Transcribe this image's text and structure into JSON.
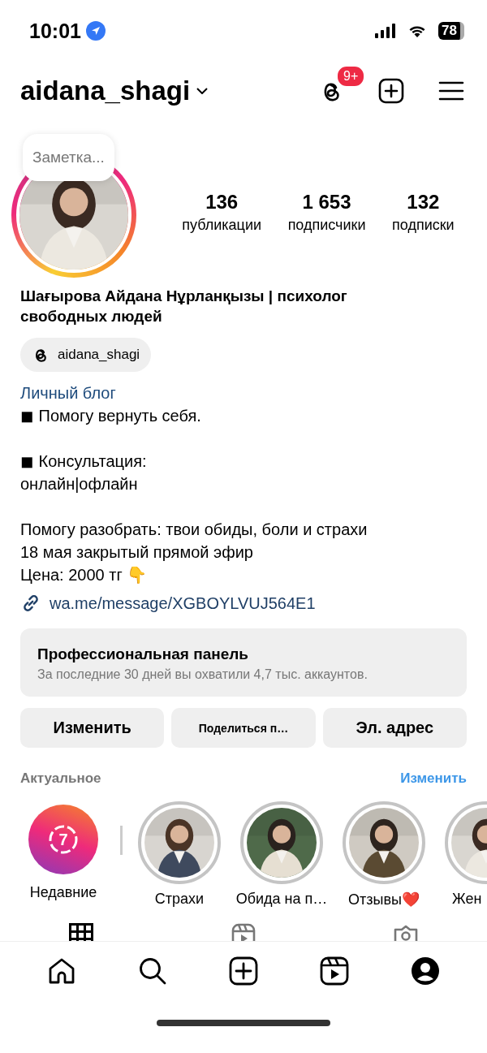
{
  "status_bar": {
    "time": "10:01",
    "battery": "78"
  },
  "header": {
    "username": "aidana_shagi",
    "threads_badge": "9+"
  },
  "profile": {
    "note": "Заметка...",
    "stats": [
      {
        "value": "136",
        "label": "публикации"
      },
      {
        "value": "1 653",
        "label": "подписчики"
      },
      {
        "value": "132",
        "label": "подписки"
      }
    ],
    "name": "Шағырова Айдана Нұрланқызы | психолог свободных людей",
    "threads_chip": "aidana_shagi",
    "category": "Личный блог",
    "bio": [
      [
        "◼ Помогу вернуть себя."
      ],
      [
        "◼ Консультация:",
        "онлайн|офлайн"
      ],
      [
        "Помогу разобрать: твои обиды, боли и страхи",
        "18 мая закрытый прямой эфир",
        "Цена: 2000 тг 👇"
      ]
    ],
    "link": "wa.me/message/XGBOYLVUJ564E1"
  },
  "dashboard": {
    "title": "Профессиональная панель",
    "subtitle": "За последние 30 дней вы охватили 4,7 тыс. аккаунтов."
  },
  "buttons": [
    "Изменить",
    "Поделиться п…",
    "Эл. адрес"
  ],
  "highlights": {
    "title": "Актуальное",
    "edit": "Изменить",
    "items": [
      {
        "kind": "recent",
        "count": "7",
        "label": "Недавние"
      },
      {
        "kind": "cover",
        "label": "Страхи"
      },
      {
        "kind": "cover",
        "label": "Обида на п…"
      },
      {
        "kind": "cover",
        "label": "Отзывы❤️"
      },
      {
        "kind": "cover",
        "label": "Жен"
      }
    ]
  },
  "profile_tabs": [
    {
      "kind": "grid",
      "selected": true
    },
    {
      "kind": "reels",
      "selected": false
    },
    {
      "kind": "tagged",
      "selected": false
    }
  ],
  "nav": [
    {
      "kind": "home"
    },
    {
      "kind": "search"
    },
    {
      "kind": "create"
    },
    {
      "kind": "reels"
    },
    {
      "kind": "profile"
    }
  ]
}
